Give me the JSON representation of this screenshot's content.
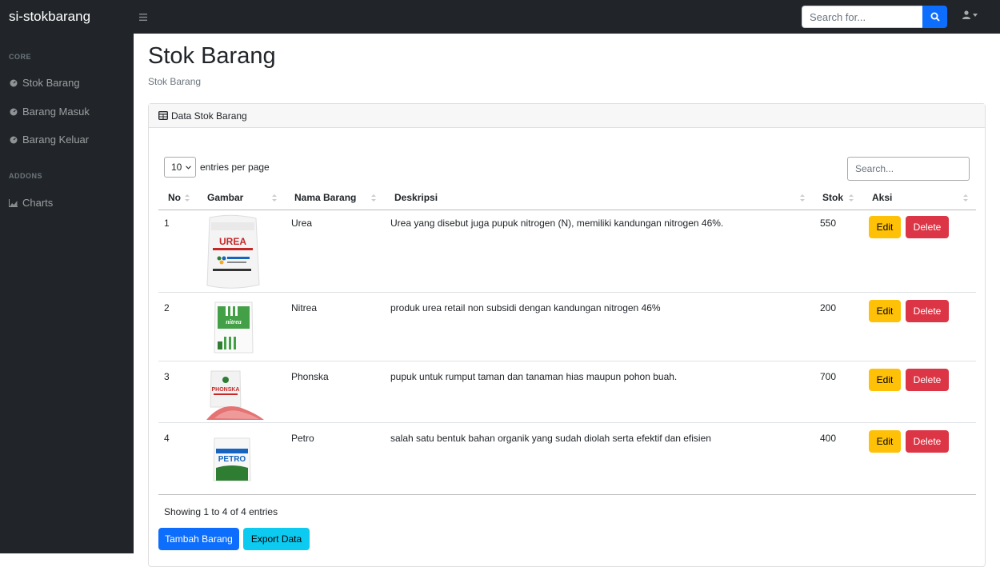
{
  "app": {
    "brand": "si-stokbarang"
  },
  "navbar": {
    "search_placeholder": "Search for..."
  },
  "sidebar": {
    "heading_core": "CORE",
    "heading_addons": "ADDONS",
    "items": [
      {
        "label": "Stok Barang",
        "icon": "tachometer-icon"
      },
      {
        "label": "Barang Masuk",
        "icon": "tachometer-icon"
      },
      {
        "label": "Barang Keluar",
        "icon": "tachometer-icon"
      },
      {
        "label": "Charts",
        "icon": "area-chart-icon"
      }
    ]
  },
  "page": {
    "title": "Stok Barang",
    "breadcrumb": "Stok Barang"
  },
  "card": {
    "header": "Data Stok Barang"
  },
  "table": {
    "length_value": "10",
    "length_label": "entries per page",
    "search_placeholder": "Search...",
    "columns": [
      "No",
      "Gambar",
      "Nama Barang",
      "Deskripsi",
      "Stok",
      "Aksi"
    ],
    "rows": [
      {
        "no": "1",
        "nama": "Urea",
        "deskripsi": "Urea yang disebut juga pupuk nitrogen (N), memiliki kandungan nitrogen 46%.",
        "stok": "550",
        "image_text": "UREA"
      },
      {
        "no": "2",
        "nama": "Nitrea",
        "deskripsi": "produk urea retail non subsidi dengan kandungan nitrogen 46%",
        "stok": "200",
        "image_text": "nitrea"
      },
      {
        "no": "3",
        "nama": "Phonska",
        "deskripsi": "pupuk untuk rumput taman dan tanaman hias maupun pohon buah.",
        "stok": "700",
        "image_text": "PHONSKA"
      },
      {
        "no": "4",
        "nama": "Petro",
        "deskripsi": "salah satu bentuk bahan organik yang sudah diolah serta efektif dan efisien",
        "stok": "400",
        "image_text": "PETRO"
      }
    ],
    "edit_label": "Edit",
    "delete_label": "Delete",
    "info": "Showing 1 to 4 of 4 entries"
  },
  "actions": {
    "add_label": "Tambah Barang",
    "export_label": "Export Data"
  },
  "colors": {
    "primary": "#0d6efd",
    "warning": "#ffc107",
    "danger": "#dc3545",
    "info": "#0dcaf0",
    "dark": "#212529"
  }
}
